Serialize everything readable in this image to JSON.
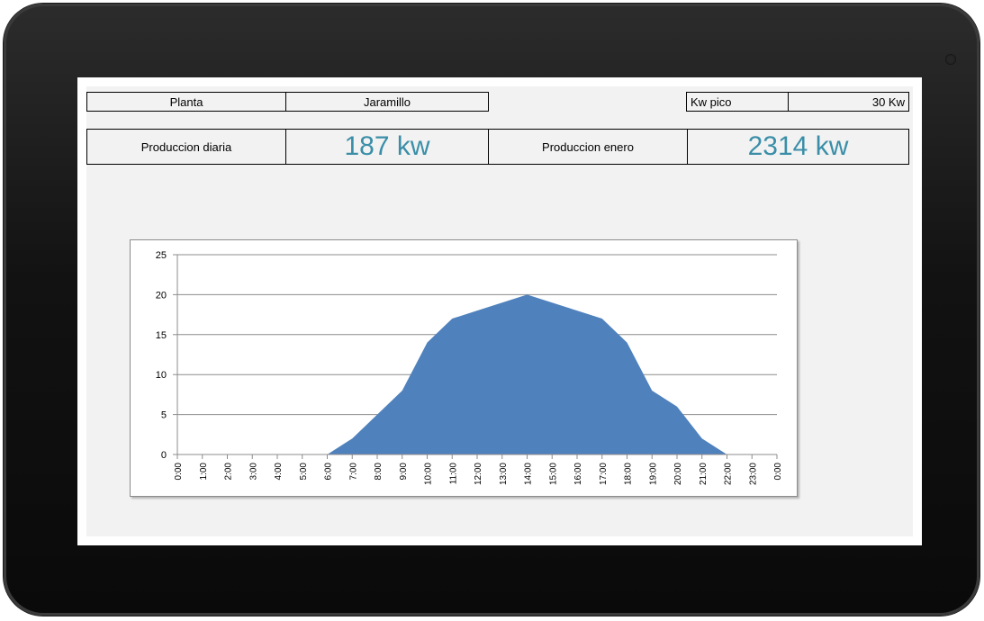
{
  "header": {
    "plant_label": "Planta",
    "plant_value": "Jaramillo",
    "peak_label": "Kw pico",
    "peak_value": "30 Kw",
    "daily_label": "Produccion diaria",
    "daily_value": "187 kw",
    "month_label": "Produccion enero",
    "month_value": "2314 kw"
  },
  "colors": {
    "area_fill": "#4f81bd",
    "value_text": "#3a8ea8"
  },
  "chart_data": {
    "type": "area",
    "x": [
      "0:00",
      "1:00",
      "2:00",
      "3:00",
      "4:00",
      "5:00",
      "6:00",
      "7:00",
      "8:00",
      "9:00",
      "10:00",
      "11:00",
      "12:00",
      "13:00",
      "14:00",
      "15:00",
      "16:00",
      "17:00",
      "18:00",
      "19:00",
      "20:00",
      "21:00",
      "22:00",
      "23:00",
      "0:00"
    ],
    "values": [
      0,
      0,
      0,
      0,
      0,
      0,
      0,
      2,
      5,
      8,
      14,
      17,
      18,
      19,
      20,
      19,
      18,
      17,
      14,
      8,
      6,
      2,
      0,
      0,
      0
    ],
    "ylim": [
      0,
      25
    ],
    "yticks": [
      "0",
      "5",
      "10",
      "15",
      "20",
      "25"
    ],
    "grid": true,
    "legend": "none"
  }
}
